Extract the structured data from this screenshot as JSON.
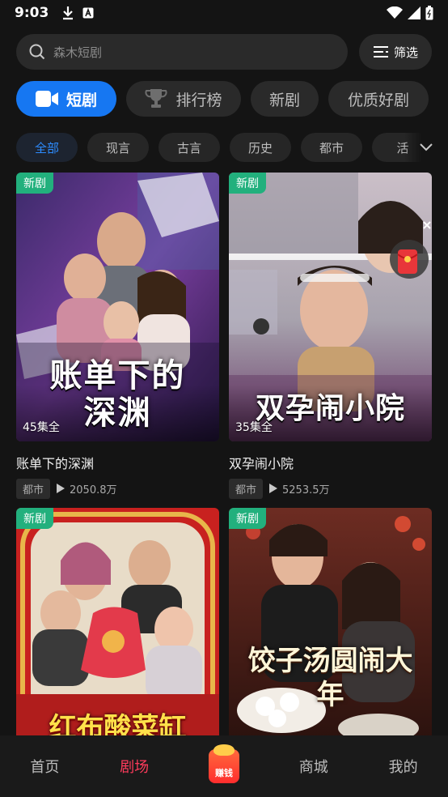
{
  "status": {
    "time": "9:03"
  },
  "search": {
    "placeholder": "森木短剧",
    "filter_label": "筛选"
  },
  "tabs": [
    {
      "label": "短剧",
      "active": true,
      "icon": "video-camera-icon"
    },
    {
      "label": "排行榜",
      "active": false,
      "icon": "trophy-icon"
    },
    {
      "label": "新剧",
      "active": false
    },
    {
      "label": "优质好剧",
      "active": false
    }
  ],
  "genres": [
    {
      "label": "全部",
      "active": true
    },
    {
      "label": "现言"
    },
    {
      "label": "古言"
    },
    {
      "label": "历史"
    },
    {
      "label": "都市"
    },
    {
      "label": "活"
    }
  ],
  "cards": [
    {
      "badge": "新剧",
      "cover_text": "账单下的深渊",
      "episodes": "45集全",
      "title": "账单下的深渊",
      "tag": "都市",
      "plays": "2050.8万"
    },
    {
      "badge": "新剧",
      "cover_text": "双孕闹小院",
      "episodes": "35集全",
      "title": "双孕闹小院",
      "tag": "都市",
      "plays": "5253.5万"
    },
    {
      "badge": "新剧",
      "cover_text": "红布酸菜缸"
    },
    {
      "badge": "新剧",
      "cover_text": "饺子汤圆闹大年"
    }
  ],
  "bottom_nav": {
    "items": [
      {
        "label": "首页",
        "active": false
      },
      {
        "label": "剧场",
        "active": true
      },
      {
        "label": "赚钱",
        "is_earn": true
      },
      {
        "label": "商城",
        "active": false
      },
      {
        "label": "我的",
        "active": false
      }
    ]
  },
  "colors": {
    "accent_blue": "#1677f2",
    "badge_green": "#22b07d",
    "active_red": "#ff3b5c"
  }
}
